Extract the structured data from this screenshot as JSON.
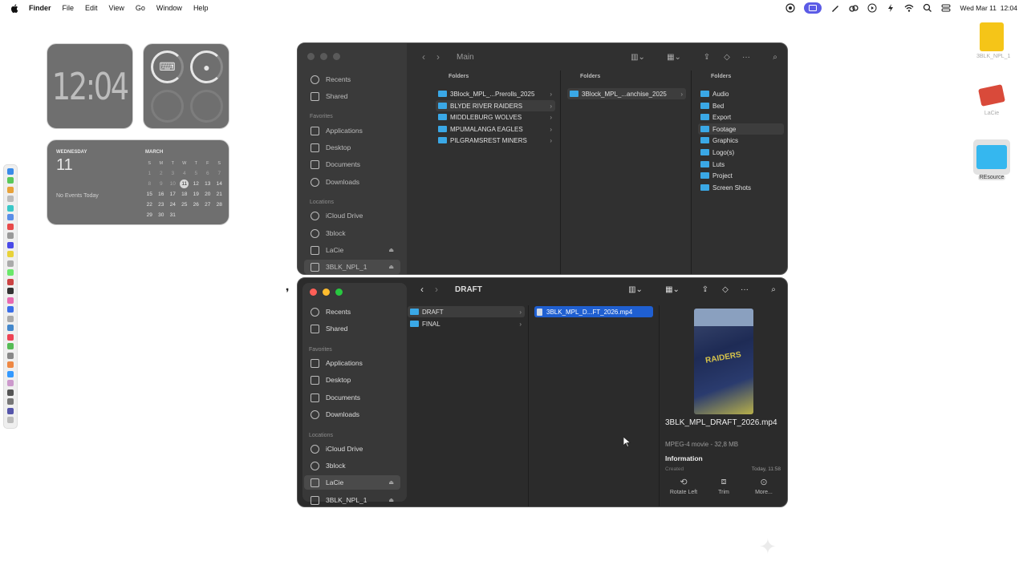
{
  "menubar": {
    "app": "Finder",
    "items": [
      "File",
      "Edit",
      "View",
      "Go",
      "Window",
      "Help"
    ],
    "datetime": "Wed Mar 11  12:04"
  },
  "widgets": {
    "clock": "12:04",
    "calendar": {
      "weekday": "WEDNESDAY",
      "day": "11",
      "events": "No Events Today",
      "month": "MARCH",
      "headers": [
        "S",
        "M",
        "T",
        "W",
        "T",
        "F",
        "S"
      ],
      "days": [
        "1",
        "2",
        "3",
        "4",
        "5",
        "6",
        "7",
        "8",
        "9",
        "10",
        "11",
        "12",
        "13",
        "14",
        "15",
        "16",
        "17",
        "18",
        "19",
        "20",
        "21",
        "22",
        "23",
        "24",
        "25",
        "26",
        "27",
        "28",
        "29",
        "30",
        "31"
      ],
      "today": "11"
    }
  },
  "desktop": {
    "drive_label": "3BLK_NPL_1",
    "lacie_label": "LaCie",
    "folder_label": "REsource"
  },
  "finder_back": {
    "title": "Main",
    "sidebar": {
      "recents": "Recents",
      "shared": "Shared",
      "favorites_header": "Favorites",
      "applications": "Applications",
      "desktop": "Desktop",
      "documents": "Documents",
      "downloads": "Downloads",
      "locations_header": "Locations",
      "icloud": "iCloud Drive",
      "block": "3block",
      "lacie": "LaCie",
      "npl": "3BLK_NPL_1"
    },
    "col1": {
      "header": "Folders",
      "items": [
        "3Block_MPL_...Prerolls_2025",
        "BLYDE RIVER RAIDERS",
        "MIDDLEBURG WOLVES",
        "MPUMALANGA EAGLES",
        "PILGRAMSREST MINERS"
      ]
    },
    "col2": {
      "header": "Folders",
      "items": [
        "3Block_MPL_...anchise_2025"
      ]
    },
    "col3": {
      "header": "Folders",
      "items": [
        "Audio",
        "Bed",
        "Export",
        "Footage",
        "Graphics",
        "Logo(s)",
        "Luts",
        "Project",
        "Screen Shots"
      ]
    }
  },
  "finder_front": {
    "title": "DRAFT",
    "sidebar": {
      "recents": "Recents",
      "shared": "Shared",
      "favorites_header": "Favorites",
      "applications": "Applications",
      "desktop": "Desktop",
      "documents": "Documents",
      "downloads": "Downloads",
      "locations_header": "Locations",
      "icloud": "iCloud Drive",
      "block": "3block",
      "lacie": "LaCie",
      "npl": "3BLK_NPL_1"
    },
    "col1": {
      "items": [
        "DRAFT",
        "FINAL"
      ]
    },
    "col2": {
      "items": [
        "3BLK_MPL_D...FT_2026.mp4"
      ]
    },
    "preview": {
      "thumb_text": "RAIDERS",
      "filename": "3BLK_MPL_DRAFT_2026.mp4",
      "meta": "MPEG-4 movie - 32,8 MB",
      "info": "Information",
      "created_label": "Created",
      "created_value": "Today, 11:58",
      "actions": [
        "Rotate Left",
        "Trim",
        "More..."
      ]
    }
  }
}
